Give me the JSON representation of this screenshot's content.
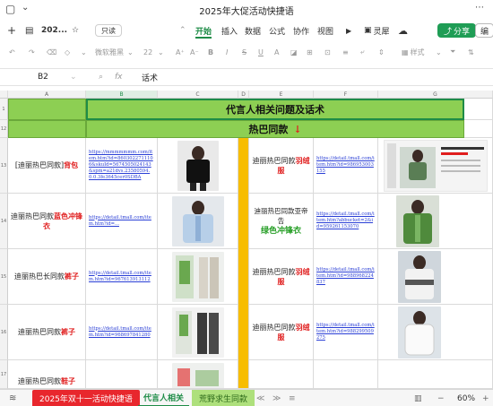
{
  "window": {
    "title": "2025年大促活动快捷语"
  },
  "toolbar": {
    "doc_short": "202...",
    "mode_chip": "只读",
    "menus": [
      "开始",
      "插入",
      "数据",
      "公式",
      "协作",
      "视图"
    ],
    "active_menu": "开始",
    "library_label": "灵犀",
    "share_label": "分享",
    "edit_label": "编"
  },
  "format_bar": {
    "font_name": "微软雅黑",
    "font_size": "22",
    "style_label": "样式"
  },
  "formula_bar": {
    "cell_ref": "B2",
    "content": "话术"
  },
  "columns": [
    "A",
    "B",
    "C",
    "D",
    "E",
    "F",
    "G"
  ],
  "selected_column": "B",
  "rows": [
    "1",
    "12",
    "13",
    "14",
    "15",
    "16",
    "17"
  ],
  "sheet": {
    "title_banner": "代言人相关问题及话术",
    "subtitle_banner": "热巴同款",
    "subtitle_arrow": "↓",
    "items": [
      {
        "left_label_plain": "[迪丽热巴同款]",
        "left_label_hl": "背包",
        "left_link": "https://mmmmmmm.com/item.htm?id=8603022711106&skuId=5674505024143&spm=a21dvs.23580594.0.0.3fe3645cer0SDBA",
        "right_label_plain": "迪丽热巴同款",
        "right_label_hl": "羽绒服",
        "right_link": "https://detail.tmall.com/item.htm?id=986953003155"
      },
      {
        "left_label_plain": "迪丽热巴同款",
        "left_label_hl": "蓝色冲锋衣",
        "left_link": "https://detail.tmall.com/item.htm?id=...",
        "right_label_plain": "迪丽热巴同款亚帝告",
        "right_label_hl": "绿色冲锋衣",
        "right_link": "https://detail.tmall.com/item.htm?abbucket=2&id=959261153070"
      },
      {
        "left_label_plain": "迪丽热巴长同款",
        "left_label_hl": "裤子",
        "left_link": "https://detail.tmall.com/item.htm?id=967613913112",
        "right_label_plain": "迪丽热巴同款",
        "right_label_hl": "羽绒服",
        "right_link": "https://detail.tmall.com/item.htm?id=988968224837"
      },
      {
        "left_label_plain": "迪丽热巴同款",
        "left_label_hl": "裤子",
        "left_link": "https://detail.tmall.com/item.htm?id=968697841280",
        "right_label_plain": "迪丽热巴同款",
        "right_label_hl": "羽绒服",
        "right_link": "https://detail.tmall.com/item.htm?id=988299509275"
      },
      {
        "left_label_plain": "迪丽热巴同款",
        "left_label_hl": "鞋子",
        "left_link": "",
        "right_label_plain": "",
        "right_label_hl": "",
        "right_link": ""
      }
    ]
  },
  "sheet_tabs": [
    "2025年双十一活动快捷语",
    "代言人相关",
    "荒野求生同款"
  ],
  "zoom": "60%",
  "colors": {
    "accent": "#1e8c47",
    "banner": "#8dcf53",
    "highlight": "#e01e1e",
    "divider": "#f7bd00",
    "active_tab": "#e8272d"
  }
}
